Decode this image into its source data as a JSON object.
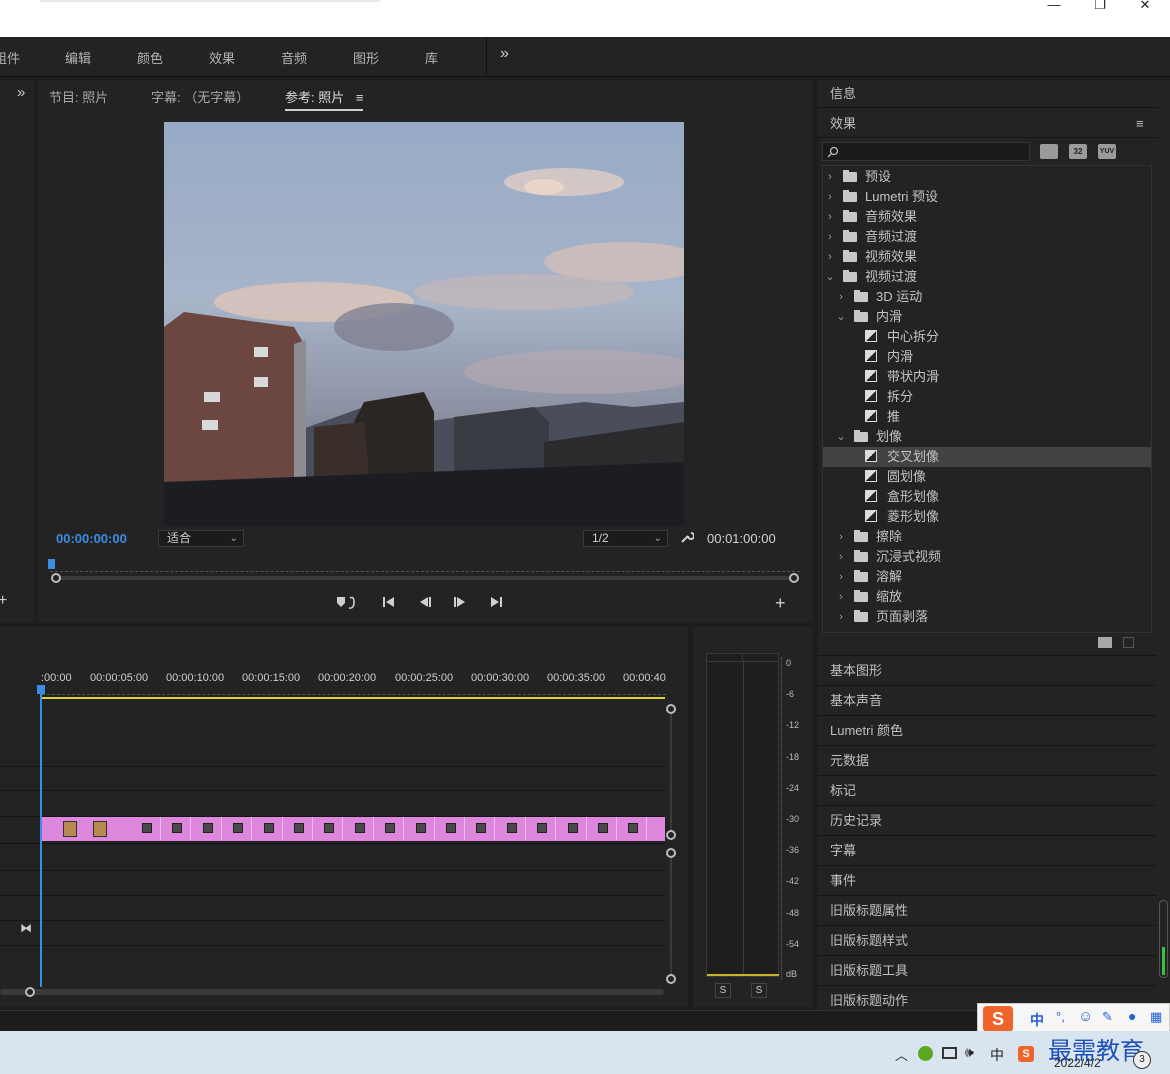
{
  "window": {
    "minimize": "—",
    "restore": "❐",
    "close": "✕"
  },
  "menu": {
    "items": [
      "组件",
      "编辑",
      "颜色",
      "效果",
      "音频",
      "图形",
      "库"
    ],
    "overflow": "»"
  },
  "monitor": {
    "tabs_overflow": "»",
    "tabs": [
      "节目: 照片",
      "字幕: （无字幕）",
      "参考: 照片"
    ],
    "tab_menu": "≡",
    "timecode_current": "00:00:00:00",
    "timecode_total": "00:01:00:00",
    "fit_select": "适合",
    "resolution_select": "1/2",
    "add": "+"
  },
  "timeline": {
    "ruler": [
      ":00:00",
      "00:00:05:00",
      "00:00:10:00",
      "00:00:15:00",
      "00:00:20:00",
      "00:00:25:00",
      "00:00:30:00",
      "00:00:35:00",
      "00:00:40"
    ],
    "clip_color": "#dd87dd",
    "playhead_color": "#3b8de4"
  },
  "meter": {
    "scale": [
      "0",
      "-6",
      "-12",
      "-18",
      "-24",
      "-30",
      "-36",
      "-42",
      "-48",
      "-54",
      "dB"
    ],
    "solo_labels": [
      "S",
      "S"
    ]
  },
  "right_panel": {
    "info_title": "信息",
    "effects_title": "效果",
    "effects_menu": "≡",
    "filter_buttons": [
      "32",
      "YUV"
    ],
    "tree": [
      {
        "label": "预设",
        "level": 0,
        "open": false,
        "kind": "preset-folder"
      },
      {
        "label": "Lumetri 预设",
        "level": 0,
        "open": false,
        "kind": "preset-folder"
      },
      {
        "label": "音频效果",
        "level": 0,
        "open": false,
        "kind": "folder"
      },
      {
        "label": "音频过渡",
        "level": 0,
        "open": false,
        "kind": "folder"
      },
      {
        "label": "视频效果",
        "level": 0,
        "open": false,
        "kind": "folder"
      },
      {
        "label": "视频过渡",
        "level": 0,
        "open": true,
        "kind": "folder"
      },
      {
        "label": "3D 运动",
        "level": 1,
        "open": false,
        "kind": "folder"
      },
      {
        "label": "内滑",
        "level": 1,
        "open": true,
        "kind": "folder"
      },
      {
        "label": "中心拆分",
        "level": 2,
        "kind": "effect"
      },
      {
        "label": "内滑",
        "level": 2,
        "kind": "effect"
      },
      {
        "label": "带状内滑",
        "level": 2,
        "kind": "effect"
      },
      {
        "label": "拆分",
        "level": 2,
        "kind": "effect"
      },
      {
        "label": "推",
        "level": 2,
        "kind": "effect"
      },
      {
        "label": "划像",
        "level": 1,
        "open": true,
        "kind": "folder"
      },
      {
        "label": "交叉划像",
        "level": 2,
        "kind": "effect",
        "selected": true
      },
      {
        "label": "圆划像",
        "level": 2,
        "kind": "effect"
      },
      {
        "label": "盒形划像",
        "level": 2,
        "kind": "effect"
      },
      {
        "label": "菱形划像",
        "level": 2,
        "kind": "effect"
      },
      {
        "label": "擦除",
        "level": 1,
        "open": false,
        "kind": "folder"
      },
      {
        "label": "沉浸式视频",
        "level": 1,
        "open": false,
        "kind": "folder"
      },
      {
        "label": "溶解",
        "level": 1,
        "open": false,
        "kind": "folder"
      },
      {
        "label": "缩放",
        "level": 1,
        "open": false,
        "kind": "folder"
      },
      {
        "label": "页面剥落",
        "level": 1,
        "open": false,
        "kind": "folder"
      }
    ],
    "stacked_panels": [
      "基本图形",
      "基本声音",
      "Lumetri 颜色",
      "元数据",
      "标记",
      "历史记录",
      "字幕",
      "事件",
      "旧版标题属性",
      "旧版标题样式",
      "旧版标题工具",
      "旧版标题动作"
    ]
  },
  "taskbar": {
    "ime_lang": "中",
    "date": "2022/4/2",
    "notification_count": "3",
    "watermark": "最需教育",
    "ime_bar": [
      "中",
      "°,",
      "☺"
    ]
  }
}
